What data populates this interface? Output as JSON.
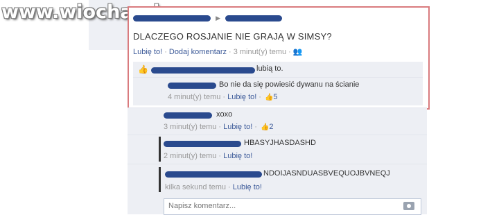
{
  "watermark": "www.wiocha.pl",
  "post": {
    "text": "DLACZEGO ROSJANIE NIE GRAJĄ W SIMSY?",
    "actions": {
      "like": "Lubię to!",
      "comment": "Dodaj komentarz",
      "time": "3 minut(y) temu"
    },
    "likes_text": "lubią to."
  },
  "comments": [
    {
      "text": "Bo nie da się powiesić dywanu na ścianie",
      "time": "4 minut(y) temu",
      "like": "Lubię to!",
      "likes_count": "5"
    },
    {
      "text": "xoxo",
      "time": "3 minut(y) temu",
      "like": "Lubię to!",
      "likes_count": "2"
    },
    {
      "text": "HBASYJHASDASHD",
      "time": "2 minut(y) temu",
      "like": "Lubię to!"
    },
    {
      "text": "NDOIJASNDUASBVEQUOJBVNEQJ",
      "time": "kilka sekund temu",
      "like": "Lubię to!"
    }
  ],
  "comment_input": {
    "placeholder": "Napisz komentarz..."
  },
  "colors": {
    "link": "#3b5998",
    "highlight_border": "#d97b7e",
    "comment_bg": "#edeff4"
  }
}
